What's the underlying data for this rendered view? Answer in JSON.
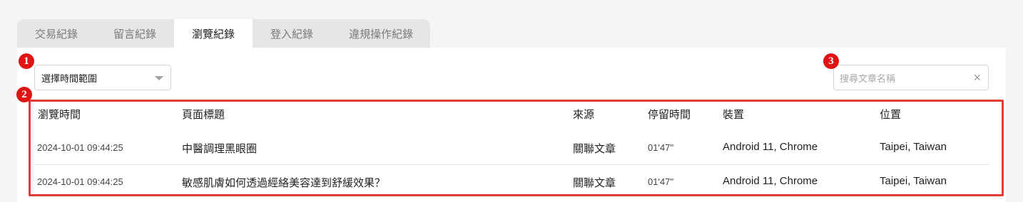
{
  "tabs": [
    {
      "label": "交易紀錄",
      "active": false
    },
    {
      "label": "留言紀錄",
      "active": false
    },
    {
      "label": "瀏覽紀錄",
      "active": true
    },
    {
      "label": "登入紀錄",
      "active": false
    },
    {
      "label": "違規操作紀錄",
      "active": false
    }
  ],
  "badges": {
    "one": "1",
    "two": "2",
    "three": "3"
  },
  "filter": {
    "select_label": "選擇時間範圍"
  },
  "search": {
    "placeholder": "搜尋文章名稱",
    "clear_glyph": "×"
  },
  "table": {
    "headers": [
      "瀏覽時間",
      "頁面標題",
      "來源",
      "停留時間",
      "裝置",
      "位置"
    ],
    "rows": [
      [
        "2024-10-01 09:44:25",
        "中醫調理黑眼圈",
        "關聯文章",
        "01'47''",
        "Android 11, Chrome",
        "Taipei, Taiwan"
      ],
      [
        "2024-10-01 09:44:25",
        "敏感肌膚如何透過經絡美容達到舒緩效果？",
        "關聯文章",
        "01'47''",
        "Android 11, Chrome",
        "Taipei, Taiwan"
      ]
    ]
  },
  "colors": {
    "highlight": "#e53935",
    "badge": "#e01414"
  }
}
